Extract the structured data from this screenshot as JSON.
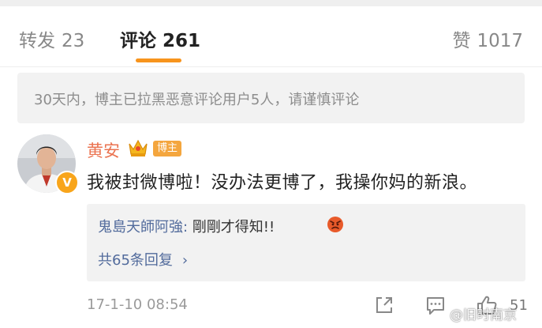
{
  "tabs": {
    "repost": {
      "label": "转发",
      "count": "23"
    },
    "comment": {
      "label": "评论",
      "count": "261"
    },
    "like": {
      "label": "赞",
      "count": "1017"
    }
  },
  "notice": "30天内，博主已拉黑恶意评论用户5人，请谨慎评论",
  "comment": {
    "username": "黄安",
    "badge": "博主",
    "verified_mark": "V",
    "text": "我被封微博啦！没办法更博了，我操你妈的新浪。",
    "reply": {
      "user": "鬼島天師阿強:",
      "text": " 剛剛才得知!!"
    },
    "more_replies": "共65条回复",
    "timestamp": "17-1-10 08:54",
    "like_count": "51"
  },
  "watermark": "@旧时南京",
  "icons": [
    "crown-icon",
    "angry-face-icon",
    "share-icon",
    "comment-icon",
    "like-icon"
  ],
  "colors": {
    "accent": "#f7941d",
    "username": "#eb7350",
    "link": "#526b9c"
  }
}
